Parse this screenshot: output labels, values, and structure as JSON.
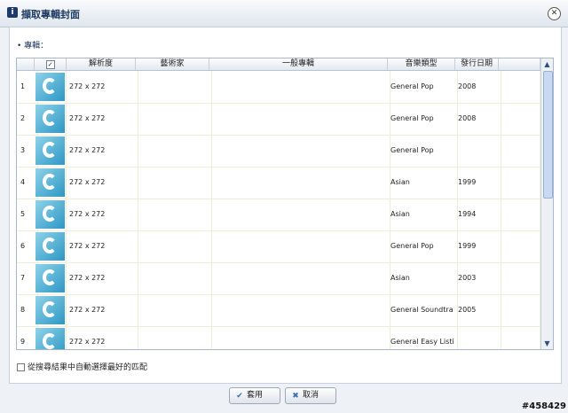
{
  "window": {
    "title": "擷取專輯封面",
    "title_icon": "info-icon"
  },
  "section": {
    "label": "專輯："
  },
  "table": {
    "headers": {
      "check": "✓",
      "resolution": "解析度",
      "artist": "藝術家",
      "album": "一般專輯",
      "genre": "音樂類型",
      "date": "發行日期"
    },
    "rows": [
      {
        "num": "1",
        "resolution": "272 x 272",
        "artist": "",
        "album": "",
        "genre": "General Pop",
        "date": "2008"
      },
      {
        "num": "2",
        "resolution": "272 x 272",
        "artist": "",
        "album": "",
        "genre": "General Pop",
        "date": "2008"
      },
      {
        "num": "3",
        "resolution": "272 x 272",
        "artist": "",
        "album": "",
        "genre": "General Pop",
        "date": ""
      },
      {
        "num": "4",
        "resolution": "272 x 272",
        "artist": "",
        "album": "",
        "genre": "Asian",
        "date": "1999"
      },
      {
        "num": "5",
        "resolution": "272 x 272",
        "artist": "",
        "album": "",
        "genre": "Asian",
        "date": "1994"
      },
      {
        "num": "6",
        "resolution": "272 x 272",
        "artist": "",
        "album": "",
        "genre": "General Pop",
        "date": "1999"
      },
      {
        "num": "7",
        "resolution": "272 x 272",
        "artist": "",
        "album": "",
        "genre": "Asian",
        "date": "2003"
      },
      {
        "num": "8",
        "resolution": "272 x 272",
        "artist": "",
        "album": "",
        "genre": "General Soundtra",
        "date": "2005"
      },
      {
        "num": "9",
        "resolution": "272 x 272",
        "artist": "",
        "album": "",
        "genre": "General Easy Listi",
        "date": ""
      }
    ]
  },
  "auto_select": {
    "label": "從搜尋結果中自動選擇最好的匹配"
  },
  "buttons": {
    "apply": "套用",
    "cancel": "取消"
  },
  "watermark": "#458429",
  "colors": {
    "title": "#1f3a63",
    "accent": "#2c97c4"
  }
}
